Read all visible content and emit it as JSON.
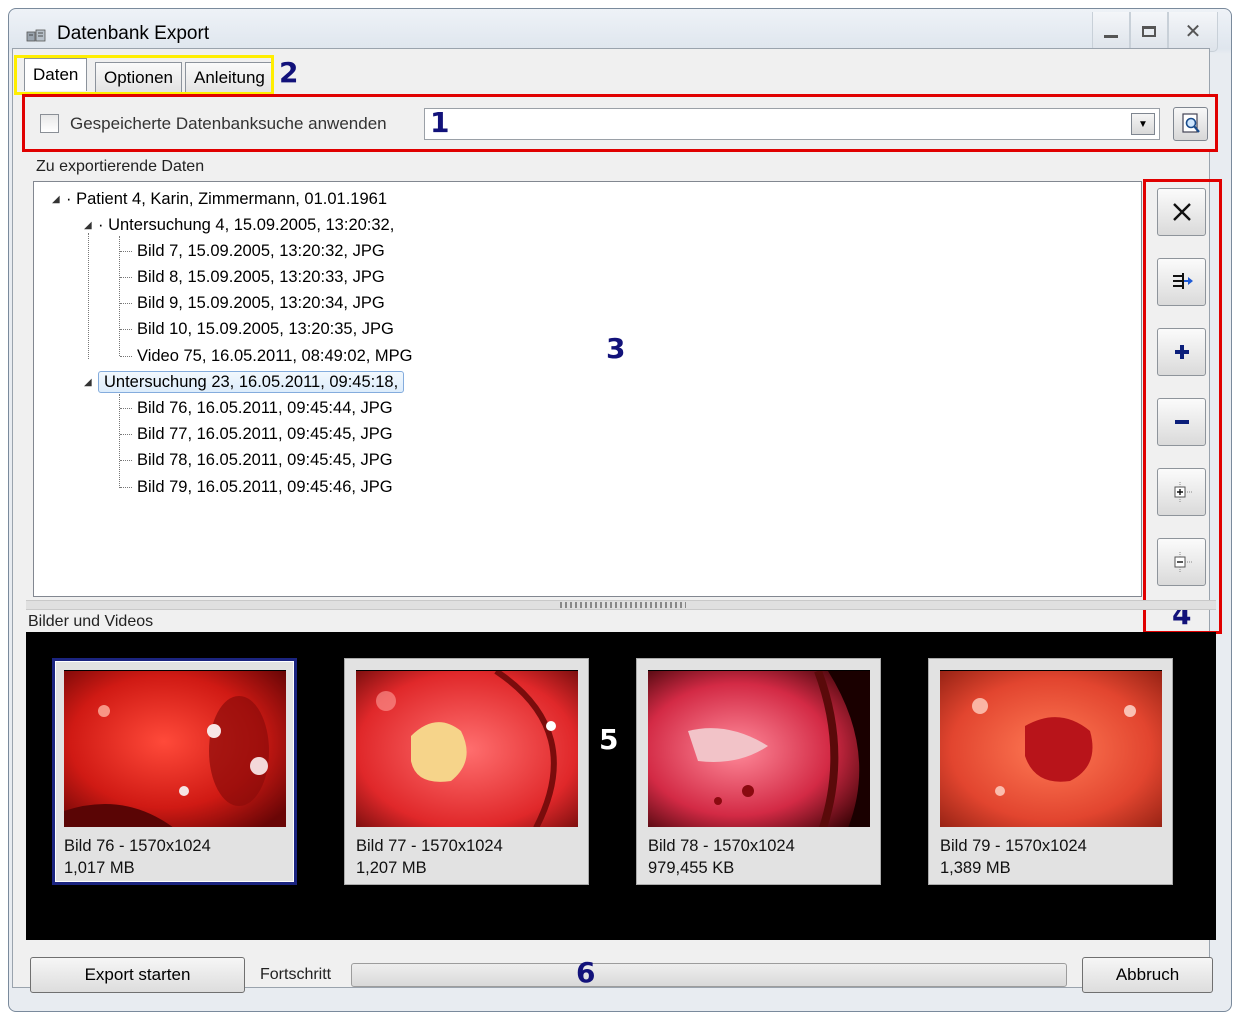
{
  "window": {
    "title": "Datenbank Export",
    "controls": [
      "minimize-icon",
      "maximize-icon",
      "close-icon"
    ]
  },
  "tabs": [
    {
      "label": "Daten",
      "active": true
    },
    {
      "label": "Optionen",
      "active": false
    },
    {
      "label": "Anleitung",
      "active": false
    }
  ],
  "callouts": {
    "one": "1",
    "two": "2",
    "three": "3",
    "four": "4",
    "five": "5",
    "six": "6"
  },
  "search": {
    "checkbox_label": "Gespeicherte Datenbanksuche anwenden",
    "checked": false,
    "combo_value": ""
  },
  "tree": {
    "section_label": "Zu exportierende Daten",
    "patient": "Patient 4, Karin, Zimmermann, 01.01.1961",
    "exams": [
      {
        "label": "Untersuchung 4, 15.09.2005, 13:20:32,",
        "items": [
          "Bild 7, 15.09.2005, 13:20:32, JPG",
          "Bild 8, 15.09.2005, 13:20:33, JPG",
          "Bild 9, 15.09.2005, 13:20:34, JPG",
          "Bild 10, 15.09.2005, 13:20:35, JPG",
          "Video 75, 16.05.2011, 08:49:02, MPG"
        ]
      },
      {
        "label": "Untersuchung 23, 16.05.2011, 09:45:18,",
        "selected": true,
        "items": [
          "Bild 76, 16.05.2011, 09:45:44, JPG",
          "Bild 77, 16.05.2011, 09:45:45, JPG",
          "Bild 78, 16.05.2011, 09:45:45, JPG",
          "Bild 79, 16.05.2011, 09:45:46, JPG"
        ]
      }
    ]
  },
  "tools": [
    "remove-icon",
    "export-arrow-icon",
    "add-icon",
    "subtract-icon",
    "expand-tree-icon",
    "collapse-tree-icon"
  ],
  "media": {
    "section_label": "Bilder und Videos",
    "thumbnails": [
      {
        "name": "Bild 76  - 1570x1024",
        "size": "1,017 MB",
        "selected": true
      },
      {
        "name": "Bild 77  - 1570x1024",
        "size": "1,207 MB",
        "selected": false
      },
      {
        "name": "Bild 78  - 1570x1024",
        "size": "979,455 KB",
        "selected": false
      },
      {
        "name": "Bild 79  - 1570x1024",
        "size": "1,389 MB",
        "selected": false
      }
    ]
  },
  "footer": {
    "start_button": "Export starten",
    "progress_label": "Fortschritt",
    "progress_value": 0,
    "cancel_button": "Abbruch"
  },
  "colors": {
    "highlight_red": "#e00000",
    "highlight_yellow": "#ffee00",
    "callout_blue": "#12127a",
    "selected_thumb_border": "#1b2480"
  }
}
